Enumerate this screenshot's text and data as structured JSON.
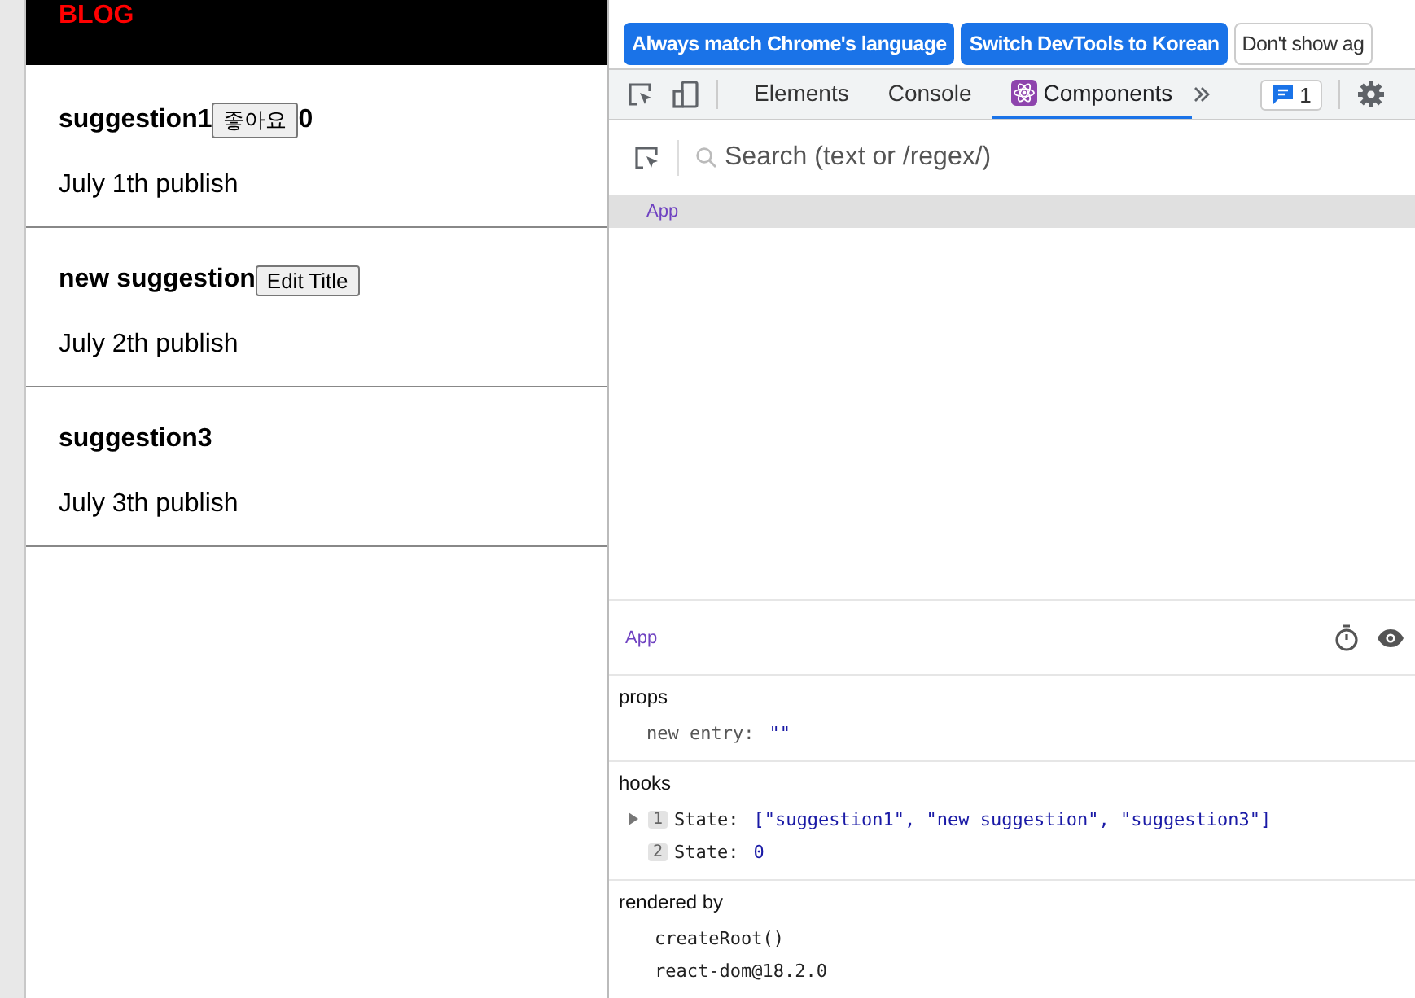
{
  "blog": {
    "title": "BLOG",
    "posts": [
      {
        "title": "suggestion1",
        "button": "좋아요",
        "likes": "0",
        "date": "July 1th publish"
      },
      {
        "title": "new suggestion",
        "button": "Edit Title",
        "date": "July 2th publish"
      },
      {
        "title": "suggestion3",
        "date": "July 3th publish"
      }
    ]
  },
  "devtools": {
    "language_bar": {
      "buttons": [
        {
          "label": "Always match Chrome's language",
          "kind": "primary"
        },
        {
          "label": "Switch DevTools to Korean",
          "kind": "primary"
        },
        {
          "label": "Don't show ag",
          "kind": "secondary"
        }
      ]
    },
    "tabs": [
      {
        "label": "Elements",
        "selected": false,
        "icon": false
      },
      {
        "label": "Console",
        "selected": false,
        "icon": false
      },
      {
        "label": "Components",
        "selected": true,
        "icon": true
      }
    ],
    "issues_count": "1",
    "search": {
      "placeholder": "Search (text or /regex/)"
    },
    "tree": [
      {
        "label": "App",
        "selected": true
      }
    ],
    "inspector": {
      "component": "App",
      "sections": [
        {
          "title": "props",
          "rows": [
            {
              "kind": "prop",
              "key": "new entry:",
              "value": "\"\""
            }
          ]
        },
        {
          "title": "hooks",
          "rows": [
            {
              "kind": "hook",
              "index": "1",
              "key": "State:",
              "value": "[\"suggestion1\", \"new suggestion\", \"suggestion3\"]",
              "expandable": true
            },
            {
              "kind": "hook",
              "index": "2",
              "key": "State:",
              "value": "0",
              "expandable": false
            }
          ]
        },
        {
          "title": "rendered by",
          "rows": [
            {
              "kind": "owner",
              "value": "createRoot()"
            },
            {
              "kind": "owner",
              "value": "react-dom@18.2.0"
            }
          ]
        }
      ]
    }
  }
}
